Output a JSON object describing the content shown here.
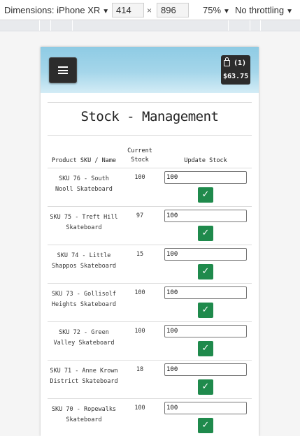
{
  "devtools": {
    "dimensions_label": "Dimensions: iPhone XR",
    "width": "414",
    "height": "896",
    "zoom": "75%",
    "throttling": "No throttling"
  },
  "header": {
    "cart_count": "(1)",
    "cart_total": "$63.75"
  },
  "page_title": "Stock - Management",
  "table": {
    "headers": {
      "name": "Product SKU / Name",
      "current_stock": "Current Stock",
      "update_stock": "Update Stock"
    },
    "rows": [
      {
        "name": "SKU 76 - South Nooll Skateboard",
        "stock": "100",
        "input": "100"
      },
      {
        "name": "SKU 75 - Treft Hill Skateboard",
        "stock": "97",
        "input": "100"
      },
      {
        "name": "SKU 74 - Little Shappos Skateboard",
        "stock": "15",
        "input": "100"
      },
      {
        "name": "SKU 73 - Gollisolf Heights Skateboard",
        "stock": "100",
        "input": "100"
      },
      {
        "name": "SKU 72 - Green Valley Skateboard",
        "stock": "100",
        "input": "100"
      },
      {
        "name": "SKU 71 - Anne Krown District Skateboard",
        "stock": "18",
        "input": "100"
      },
      {
        "name": "SKU 70 - Ropewalks Skateboard",
        "stock": "100",
        "input": "100"
      }
    ],
    "update_button_glyph": "✓"
  },
  "colors": {
    "header_gradient_top": "#8ecbe4",
    "button_dark": "#2c2c2c",
    "update_green": "#1f8a4c"
  },
  "icons": [
    "hamburger-menu-icon",
    "shopping-bag-icon",
    "checkmark-icon",
    "caret-down-icon"
  ]
}
